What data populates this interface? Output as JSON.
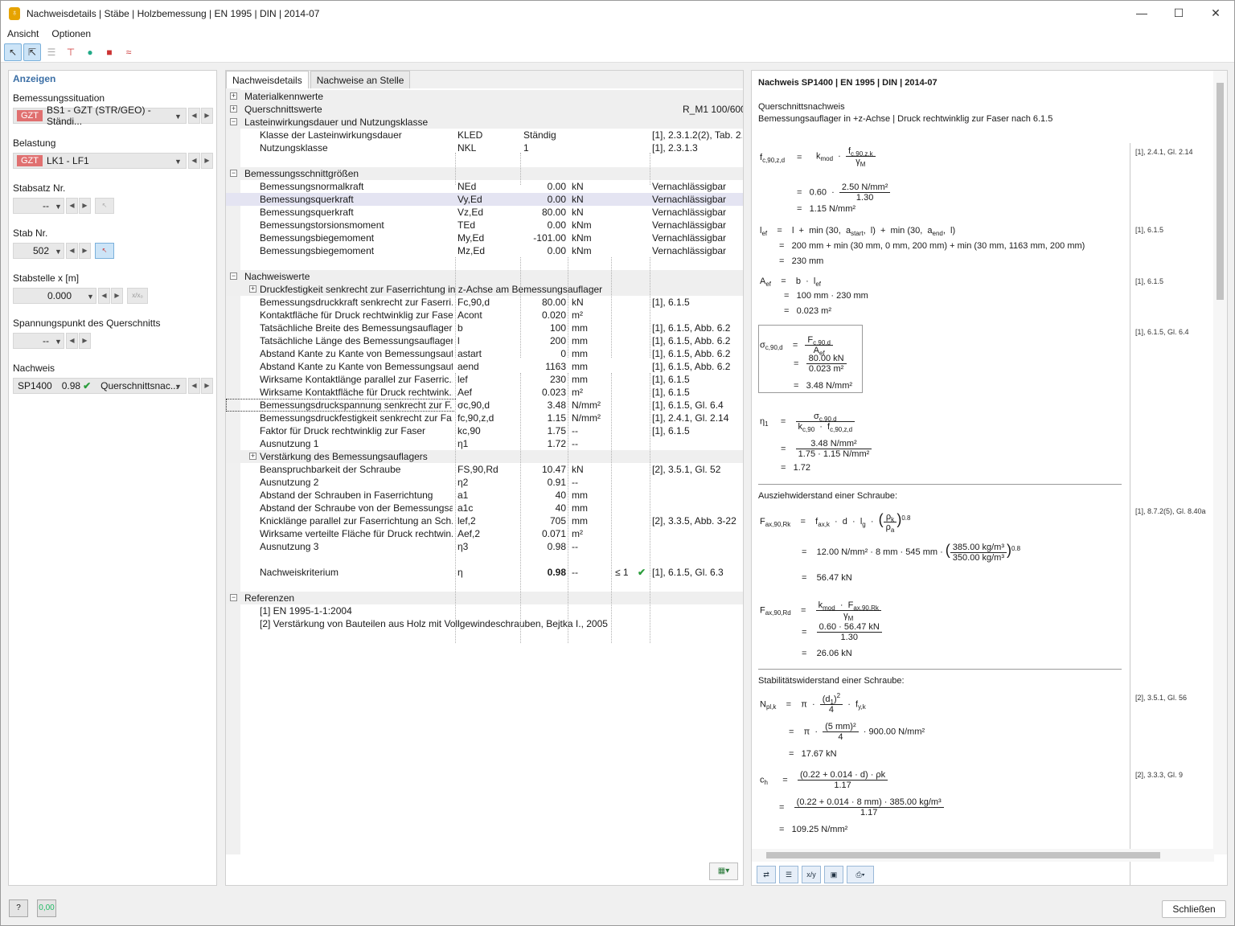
{
  "window": {
    "title": "Nachweisdetails | Stäbe | Holzbemessung | EN 1995 | DIN | 2014-07",
    "minimize": "—",
    "maximize": "☐",
    "close": "✕"
  },
  "menu": [
    "Ansicht",
    "Optionen"
  ],
  "left": {
    "header": "Anzeigen",
    "situation_label": "Bemessungssituation",
    "situation_tag": "GZT",
    "situation_value": "BS1 - GZT (STR/GEO) - Ständi...",
    "load_label": "Belastung",
    "load_tag": "GZT",
    "load_value": "LK1 - LF1",
    "set_label": "Stabsatz Nr.",
    "set_value": "--",
    "member_label": "Stab Nr.",
    "member_value": "502",
    "location_label": "Stabstelle x [m]",
    "location_value": "0.000",
    "location_unit": "x/x₀",
    "stresspoint_label": "Spannungspunkt des Querschnitts",
    "stresspoint_value": "--",
    "check_label": "Nachweis",
    "check_id": "SP1400",
    "check_ratio": "0.98",
    "check_type": "Querschnittsnac..."
  },
  "middle": {
    "tabs": [
      "Nachweisdetails",
      "Nachweise an Stelle"
    ],
    "rows": [
      {
        "t": "sec",
        "l": 0,
        "pm": "+",
        "a": "Materialkennwerte"
      },
      {
        "t": "sec",
        "l": 0,
        "pm": "+",
        "a": "Querschnittswerte",
        "f": "R_M1 100/600"
      },
      {
        "t": "sec",
        "l": 0,
        "pm": "−",
        "a": "Lasteinwirkungsdauer und Nutzungsklasse"
      },
      {
        "t": "row",
        "l": 1,
        "a": "Klasse der Lasteinwirkungsdauer",
        "b": "KLED",
        "c": "Ständig",
        "f": "[1], 2.3.1.2(2), Tab. 2.1"
      },
      {
        "t": "row",
        "l": 1,
        "a": "Nutzungsklasse",
        "b": "NKL",
        "c": "1",
        "f": "[1], 2.3.1.3"
      },
      {
        "t": "gap"
      },
      {
        "t": "sec",
        "l": 0,
        "pm": "−",
        "a": "Bemessungsschnittgrößen"
      },
      {
        "t": "row",
        "l": 1,
        "a": "Bemessungsnormalkraft",
        "b": "NEd",
        "c": "0.00",
        "d": "kN",
        "f": "Vernachlässigbar"
      },
      {
        "t": "sel",
        "l": 1,
        "a": "Bemessungsquerkraft",
        "b": "Vy,Ed",
        "c": "0.00",
        "d": "kN",
        "f": "Vernachlässigbar"
      },
      {
        "t": "row",
        "l": 1,
        "a": "Bemessungsquerkraft",
        "b": "Vz,Ed",
        "c": "80.00",
        "d": "kN",
        "f": "Vernachlässigbar"
      },
      {
        "t": "row",
        "l": 1,
        "a": "Bemessungstorsionsmoment",
        "b": "TEd",
        "c": "0.00",
        "d": "kNm",
        "f": "Vernachlässigbar"
      },
      {
        "t": "row",
        "l": 1,
        "a": "Bemessungsbiegemoment",
        "b": "My,Ed",
        "c": "-101.00",
        "d": "kNm",
        "f": "Vernachlässigbar"
      },
      {
        "t": "row",
        "l": 1,
        "a": "Bemessungsbiegemoment",
        "b": "Mz,Ed",
        "c": "0.00",
        "d": "kNm",
        "f": "Vernachlässigbar"
      },
      {
        "t": "gap"
      },
      {
        "t": "sec",
        "l": 0,
        "pm": "−",
        "a": "Nachweiswerte"
      },
      {
        "t": "sec",
        "l": 1,
        "pm": "+",
        "a": "Druckfestigkeit senkrecht zur Faserrichtung in z-Achse am Bemessungsauflager"
      },
      {
        "t": "row",
        "l": 1,
        "a": "Bemessungsdruckkraft senkrecht zur Faserri...",
        "b": "Fc,90,d",
        "c": "80.00",
        "d": "kN",
        "f": "[1], 6.1.5"
      },
      {
        "t": "row",
        "l": 1,
        "a": "Kontaktfläche für Druck rechtwinklig zur Faser",
        "b": "Acont",
        "c": "0.020",
        "d": "m²"
      },
      {
        "t": "row",
        "l": 1,
        "a": "Tatsächliche Breite des Bemessungsauflagers",
        "b": "b",
        "c": "100",
        "d": "mm",
        "f": "[1], 6.1.5, Abb. 6.2"
      },
      {
        "t": "row",
        "l": 1,
        "a": "Tatsächliche Länge des Bemessungsauflagers",
        "b": "l",
        "c": "200",
        "d": "mm",
        "f": "[1], 6.1.5, Abb. 6.2"
      },
      {
        "t": "row",
        "l": 1,
        "a": "Abstand Kante zu Kante von Bemessungsauf...",
        "b": "astart",
        "c": "0",
        "d": "mm",
        "f": "[1], 6.1.5, Abb. 6.2"
      },
      {
        "t": "row",
        "l": 1,
        "a": "Abstand Kante zu Kante von Bemessungsauf...",
        "b": "aend",
        "c": "1163",
        "d": "mm",
        "f": "[1], 6.1.5, Abb. 6.2"
      },
      {
        "t": "row",
        "l": 1,
        "a": "Wirksame Kontaktlänge parallel zur Faserric...",
        "b": "lef",
        "c": "230",
        "d": "mm",
        "f": "[1], 6.1.5"
      },
      {
        "t": "row",
        "l": 1,
        "a": "Wirksame Kontaktfläche für Druck rechtwink...",
        "b": "Aef",
        "c": "0.023",
        "d": "m²",
        "f": "[1], 6.1.5"
      },
      {
        "t": "focus",
        "l": 1,
        "a": "Bemessungsdruckspannung senkrecht zur F...",
        "b": "σc,90,d",
        "c": "3.48",
        "d": "N/mm²",
        "f": "[1], 6.1.5, Gl. 6.4"
      },
      {
        "t": "row",
        "l": 1,
        "a": "Bemessungsdruckfestigkeit senkrecht zur Fa...",
        "b": "fc,90,z,d",
        "c": "1.15",
        "d": "N/mm²",
        "f": "[1], 2.4.1, Gl. 2.14"
      },
      {
        "t": "row",
        "l": 1,
        "a": "Faktor für Druck rechtwinklig zur Faser",
        "b": "kc,90",
        "c": "1.75",
        "d": "--",
        "f": "[1], 6.1.5"
      },
      {
        "t": "row",
        "l": 1,
        "a": "Ausnutzung 1",
        "b": "η1",
        "c": "1.72",
        "d": "--"
      },
      {
        "t": "sec",
        "l": 1,
        "pm": "+",
        "a": "Verstärkung des Bemessungsauflagers"
      },
      {
        "t": "row",
        "l": 1,
        "a": "Beanspruchbarkeit der Schraube",
        "b": "FS,90,Rd",
        "c": "10.47",
        "d": "kN",
        "f": "[2], 3.5.1, Gl. 52"
      },
      {
        "t": "row",
        "l": 1,
        "a": "Ausnutzung 2",
        "b": "η2",
        "c": "0.91",
        "d": "--"
      },
      {
        "t": "row",
        "l": 1,
        "a": "Abstand der Schrauben in Faserrichtung",
        "b": "a1",
        "c": "40",
        "d": "mm"
      },
      {
        "t": "row",
        "l": 1,
        "a": "Abstand der Schraube von der Bemessungsa...",
        "b": "a1c",
        "c": "40",
        "d": "mm"
      },
      {
        "t": "row",
        "l": 1,
        "a": "Knicklänge parallel zur Faserrichtung an Sch...",
        "b": "lef,2",
        "c": "705",
        "d": "mm",
        "f": "[2], 3.3.5, Abb. 3-22"
      },
      {
        "t": "row",
        "l": 1,
        "a": "Wirksame verteilte Fläche für Druck rechtwin...",
        "b": "Aef,2",
        "c": "0.071",
        "d": "m²"
      },
      {
        "t": "row",
        "l": 1,
        "a": "Ausnutzung 3",
        "b": "η3",
        "c": "0.98",
        "d": "--"
      },
      {
        "t": "gap"
      },
      {
        "t": "crit",
        "l": 1,
        "a": "Nachweiskriterium",
        "b": "η",
        "c": "0.98",
        "d": "--",
        "e": "≤ 1",
        "f": "[1], 6.1.5, Gl. 6.3"
      },
      {
        "t": "gap"
      },
      {
        "t": "sec",
        "l": 0,
        "pm": "−",
        "a": "Referenzen"
      },
      {
        "t": "row",
        "l": 1,
        "a": "[1]  EN 1995-1-1:2004",
        "span": true
      },
      {
        "t": "row",
        "l": 1,
        "a": "[2]  Verstärkung von Bauteilen aus Holz mit Vollgewindeschrauben, Bejtka I., 2005",
        "span": true
      }
    ]
  },
  "right": {
    "title": "Nachweis SP1400 | EN 1995 | DIN | 2014-07",
    "sub1": "Querschnittsnachweis",
    "sub2": "Bemessungsauflager in +z-Achse | Druck rechtwinklig zur Faser nach 6.1.5",
    "ref_fc": "[1], 2.4.1, Gl. 2.14",
    "ref_lef": "[1], 6.1.5",
    "ref_aef": "[1], 6.1.5",
    "ref_sigma": "[1], 6.1.5, Gl. 6.4",
    "ref_fax": "[1], 8.7.2(5), Gl. 8.40a",
    "ref_npl": "[2], 3.5.1, Gl. 56",
    "ref_ch": "[2], 3.3.3, Gl. 9",
    "sec_pull": "Ausziehwiderstand einer Schraube:",
    "sec_stab": "Stabilitätswiderstand einer Schraube:",
    "v_fc1": "0.60",
    "v_fc_n": "2.50 N/mm²",
    "v_fc_d": "1.30",
    "v_fc_res": "1.15 N/mm²",
    "v_lef_line2": "200 mm  +  min (30 mm,  0 mm,  200 mm)  +  min (30 mm,  1163 mm,  200 mm)",
    "v_lef_res": "230 mm",
    "v_aef_line2": "100 mm  ·  230 mm",
    "v_aef_res": "0.023 m²",
    "v_sig_n": "80.00 kN",
    "v_sig_d": "0.023 m²",
    "v_sig_res": "3.48 N/mm²",
    "v_eta_n": "3.48 N/mm²",
    "v_eta_d": "1.75  ·  1.15 N/mm²",
    "v_eta_res": "1.72",
    "v_fax_line2a": "12.00 N/mm²  ·  8 mm  ·  545 mm  ·",
    "v_fax_pn": "385.00 kg/m³",
    "v_fax_pd": "350.00 kg/m³",
    "v_fax_res": "56.47 kN",
    "v_fard_n": "0.60  ·  56.47 kN",
    "v_fard_d": "1.30",
    "v_fard_res": "26.06 kN",
    "v_npl_n": "(5 mm)²",
    "v_npl_d": "4",
    "v_npl_f": "·  900.00 N/mm²",
    "v_npl_res": "17.67 kN",
    "v_ch_n": "(0.22  +  0.014  ·  d)  ·  ρk",
    "v_ch_d": "1.17",
    "v_ch_n2": "(0.22  +  0.014  ·  8 mm)  ·  385.00 kg/m³",
    "v_ch_d2": "1.17",
    "v_ch_res": "109.25 N/mm²"
  },
  "status": {
    "close_label": "Schließen"
  }
}
